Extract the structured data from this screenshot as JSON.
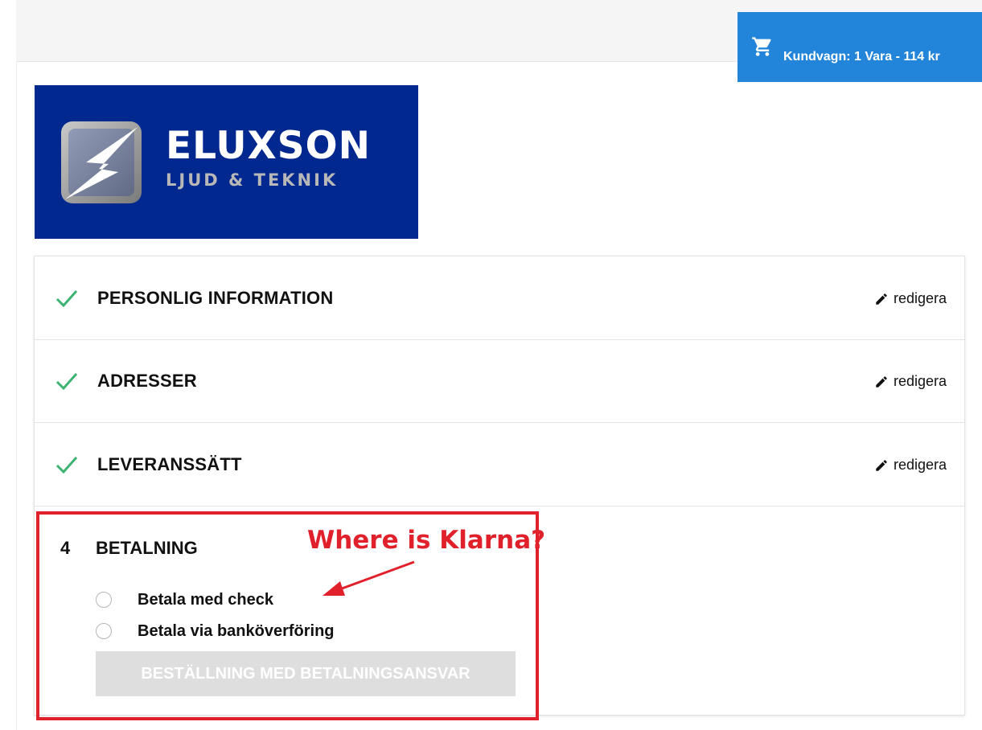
{
  "cart": {
    "label": "Kundvagn: 1 Vara - 114 kr",
    "icon": "cart-icon",
    "color": "#2385d9"
  },
  "logo": {
    "brand": "ELUXSON",
    "tagline": "LJUD & TEKNIK",
    "background": "#00288f"
  },
  "steps": [
    {
      "title": "PERSONLIG INFORMATION",
      "status": "completed",
      "icon": "checkmark-icon",
      "edit_label": "redigera"
    },
    {
      "title": "ADRESSER",
      "status": "completed",
      "icon": "checkmark-icon",
      "edit_label": "redigera"
    },
    {
      "title": "LEVERANSSÄTT",
      "status": "completed",
      "icon": "checkmark-icon",
      "edit_label": "redigera"
    }
  ],
  "payment": {
    "number": "4",
    "title": "BETALNING",
    "options": [
      {
        "label": "Betala med check",
        "selected": false
      },
      {
        "label": "Betala via banköverföring",
        "selected": false
      }
    ],
    "order_button": "BESTÄLLNING MED BETALNINGSANSVAR"
  },
  "annotation": {
    "text": "Where is Klarna?",
    "color": "#e0202a"
  },
  "colors": {
    "check": "#3cb371"
  }
}
